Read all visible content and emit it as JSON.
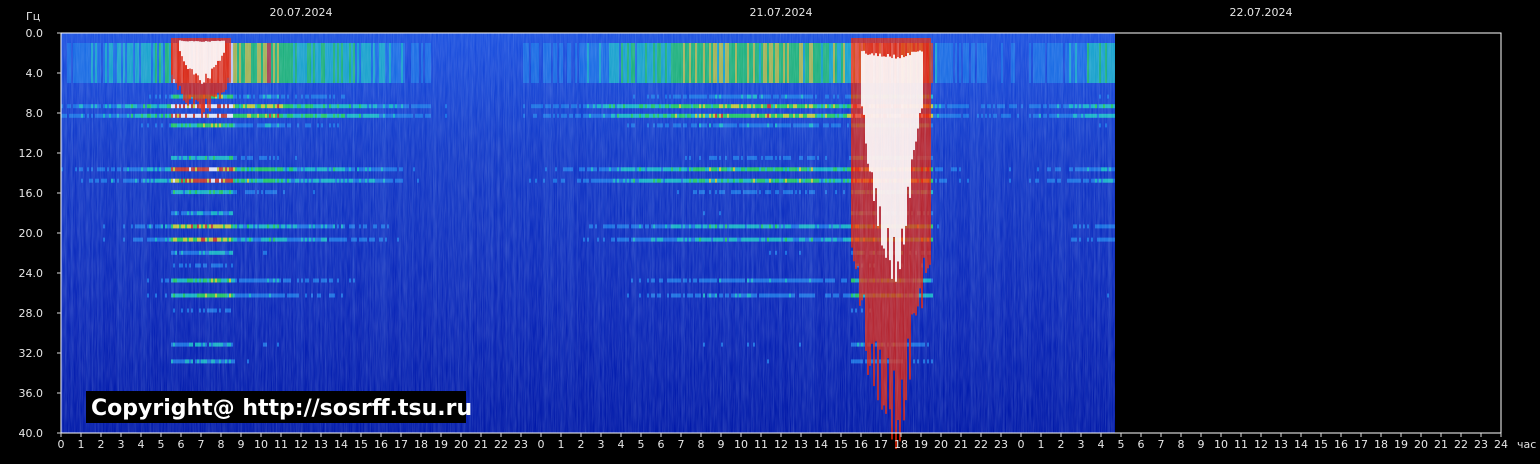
{
  "chart_data": {
    "type": "heatmap",
    "title": "",
    "ylabel": "Гц",
    "xlabel": "час",
    "y_ticks": [
      "0.0",
      "4.0",
      "8.0",
      "12.0",
      "16.0",
      "20.0",
      "24.0",
      "28.0",
      "32.0",
      "36.0",
      "40.0"
    ],
    "ylim": [
      0,
      40
    ],
    "dates": [
      "20.07.2024",
      "21.07.2024",
      "22.07.2024"
    ],
    "x_ticks": [
      "0",
      "1",
      "2",
      "3",
      "4",
      "5",
      "6",
      "7",
      "8",
      "9",
      "10",
      "11",
      "12",
      "13",
      "14",
      "15",
      "16",
      "17",
      "18",
      "19",
      "20",
      "21",
      "22",
      "23",
      "0",
      "1",
      "2",
      "3",
      "4",
      "5",
      "6",
      "7",
      "8",
      "9",
      "10",
      "11",
      "12",
      "13",
      "14",
      "15",
      "16",
      "17",
      "18",
      "19",
      "20",
      "21",
      "22",
      "23",
      "0",
      "1",
      "2",
      "3",
      "4",
      "5",
      "6",
      "7",
      "8",
      "9",
      "10",
      "11",
      "12",
      "13",
      "14",
      "15",
      "16",
      "17",
      "18",
      "19",
      "20",
      "21",
      "22",
      "23",
      "24"
    ],
    "data_end_hour": 52.7,
    "total_hours": 72,
    "resonance_bands_hz": [
      7.8,
      14.2,
      20.0,
      25.5,
      32.0
    ],
    "intense_events": [
      {
        "start_hour": 5.5,
        "end_hour": 8.5,
        "max_hz": 8.0
      },
      {
        "start_hour": 39.5,
        "end_hour": 43.5,
        "max_hz": 40.0
      }
    ],
    "colors": {
      "background": "#000000",
      "low": "#0022cc",
      "mid": "#22dd55",
      "high": "#ee2200",
      "peak": "#ffffff"
    },
    "annotation": "Copyright@ http://sosrff.tsu.ru"
  }
}
